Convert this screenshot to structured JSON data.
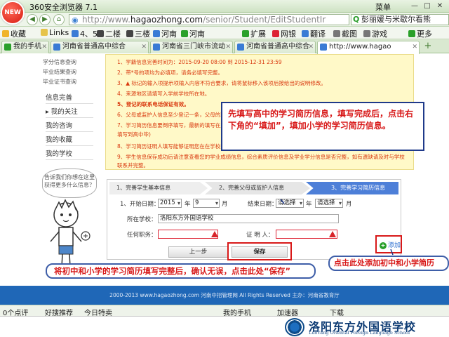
{
  "browser": {
    "badge": "NEW",
    "title": "360安全浏览器 7.1",
    "menu_label": "菜单",
    "win_min": "—",
    "win_max": "□",
    "win_close": "✕",
    "url_prefix": "http://www.",
    "url_host": "hagaozhong.com",
    "url_path": "/senior/Student/EditStudentIr",
    "search_text": "彭丽媛与米歇尔看熊",
    "nav_back": "◀",
    "nav_forward": "▶",
    "nav_refresh": "↻",
    "nav_home": "⌂"
  },
  "favorites": [
    {
      "label": "收藏",
      "icon_color": "#f0b429"
    },
    {
      "label": "Links",
      "icon_color": "#e6c34a"
    },
    {
      "label": "4、5",
      "icon_color": "#3a7bd5"
    },
    {
      "label": "二楼",
      "icon_color": "#444444"
    },
    {
      "label": "三楼",
      "icon_color": "#444444"
    },
    {
      "label": "河南",
      "icon_color": "#3a7bd5"
    },
    {
      "label": "河南",
      "icon_color": "#2aa02a"
    },
    {
      "label": "扩展",
      "icon_color": "#2aa02a"
    },
    {
      "label": "网银",
      "icon_color": "#d23"
    },
    {
      "label": "翻译",
      "icon_color": "#3a7bd5"
    },
    {
      "label": "截图",
      "icon_color": "#777"
    },
    {
      "label": "游戏",
      "icon_color": "#777"
    },
    {
      "label": "更多",
      "icon_color": "#2aa02a"
    }
  ],
  "tabs": [
    {
      "label": "我的手机",
      "icon_color": "#2aa02a"
    },
    {
      "label": "河南省普通高中综合",
      "icon_color": "#3a7bd5"
    },
    {
      "label": "河南省三门峡市流动",
      "icon_color": "#3a7bd5"
    },
    {
      "label": "河南省普通高中综合",
      "icon_color": "#3a7bd5"
    },
    {
      "label": "http://www.hagao",
      "icon_color": "#3a7bd5"
    }
  ],
  "tab_plus": "+",
  "sidebar": {
    "small_items": [
      "学分信息查询",
      "毕业结果查询",
      "毕业证书查询"
    ],
    "headers": [
      "信息完善",
      "我的关注",
      "我的咨询",
      "我的收藏",
      "我的学校"
    ],
    "bubble": "告诉我们你想在这里获得更多什么信息？"
  },
  "notice": [
    {
      "text": "1、学籍信息完善时间为：2015-09-20 08:00 到 2015-12-31 23:59",
      "bold": false
    },
    {
      "text": "2、带*号的项均为必填项，请务必填写完整。",
      "bold": false
    },
    {
      "text": "3、▲ 标记的输入项提示项输入内容不符合要求，请将鼠标移入该项后按给出的说明修改。",
      "bold": false
    },
    {
      "text": "4、来源地区请填写入学前学校所在地。",
      "bold": false
    },
    {
      "text": "5、登记的联系电话保证有效。",
      "bold": true
    },
    {
      "text": "6、父母或监护人信息至少登记一条，父母的联系",
      "bold": false
    },
    {
      "text": "7、学习简历信息要倒序填写，最新的填写在上面",
      "bold": false
    },
    {
      "text": "   填写到高中毕)",
      "bold": false
    },
    {
      "text": "8、学习简历证明人填写能够证明您在在学校担任",
      "bold": false
    },
    {
      "text": "9、学生信息保存成功后请注意查看您的学业成绩信息，综合素质评价信息及学业学分信息是否完整，如有遗缺请及时与学校",
      "bold": false
    },
    {
      "text": "   联系并完整。",
      "bold": false
    }
  ],
  "steps": [
    "1、完善学生基本信息",
    "2、完善父母或监护人信息",
    "3、完善学习简历信息"
  ],
  "form": {
    "start_label": "1、开始日期：",
    "start_year": "2015",
    "year_unit": "年",
    "start_month": "9",
    "month_unit": "月",
    "end_label": "结束日期：",
    "end_year": "请选择",
    "end_month": "请选择",
    "school_label": "所在学校：",
    "school_value": "洛阳东方外国语学校",
    "position_label": "任何职务：",
    "witness_label": "证 明 人："
  },
  "buttons": {
    "prev": "上一步",
    "save": "保存",
    "add": "添加",
    "add_icon": "+"
  },
  "callouts": {
    "main": "先填写高中的学习简历信息，填写完成后，点击右下角的“填加”，填加小学的学习简历信息。",
    "bottom": "将初中和小学的学习简历填写完整后，确认无误，点击此处“保存”",
    "right": "点击此处添加初中和小学简历"
  },
  "footer_text": "2000-2013 www.hagaozhong.com 河南中招管理网 All Rights Reserved 主办：河南省教育厅",
  "status": [
    {
      "label": "0个点评"
    },
    {
      "label": "好搜推荐"
    },
    {
      "label": "今日特卖"
    },
    {
      "label": "我的手机"
    },
    {
      "label": "加速器"
    },
    {
      "label": "下载"
    }
  ],
  "school": {
    "name_cn": "洛阳东方外国语学校",
    "name_en": "LuoYang Oriental Foreign Language School"
  },
  "colors": {
    "callout_text": "#d81919",
    "highlight_box": "#d81919",
    "active_step": "#4d7fd8",
    "footer": "#1f67b7"
  }
}
